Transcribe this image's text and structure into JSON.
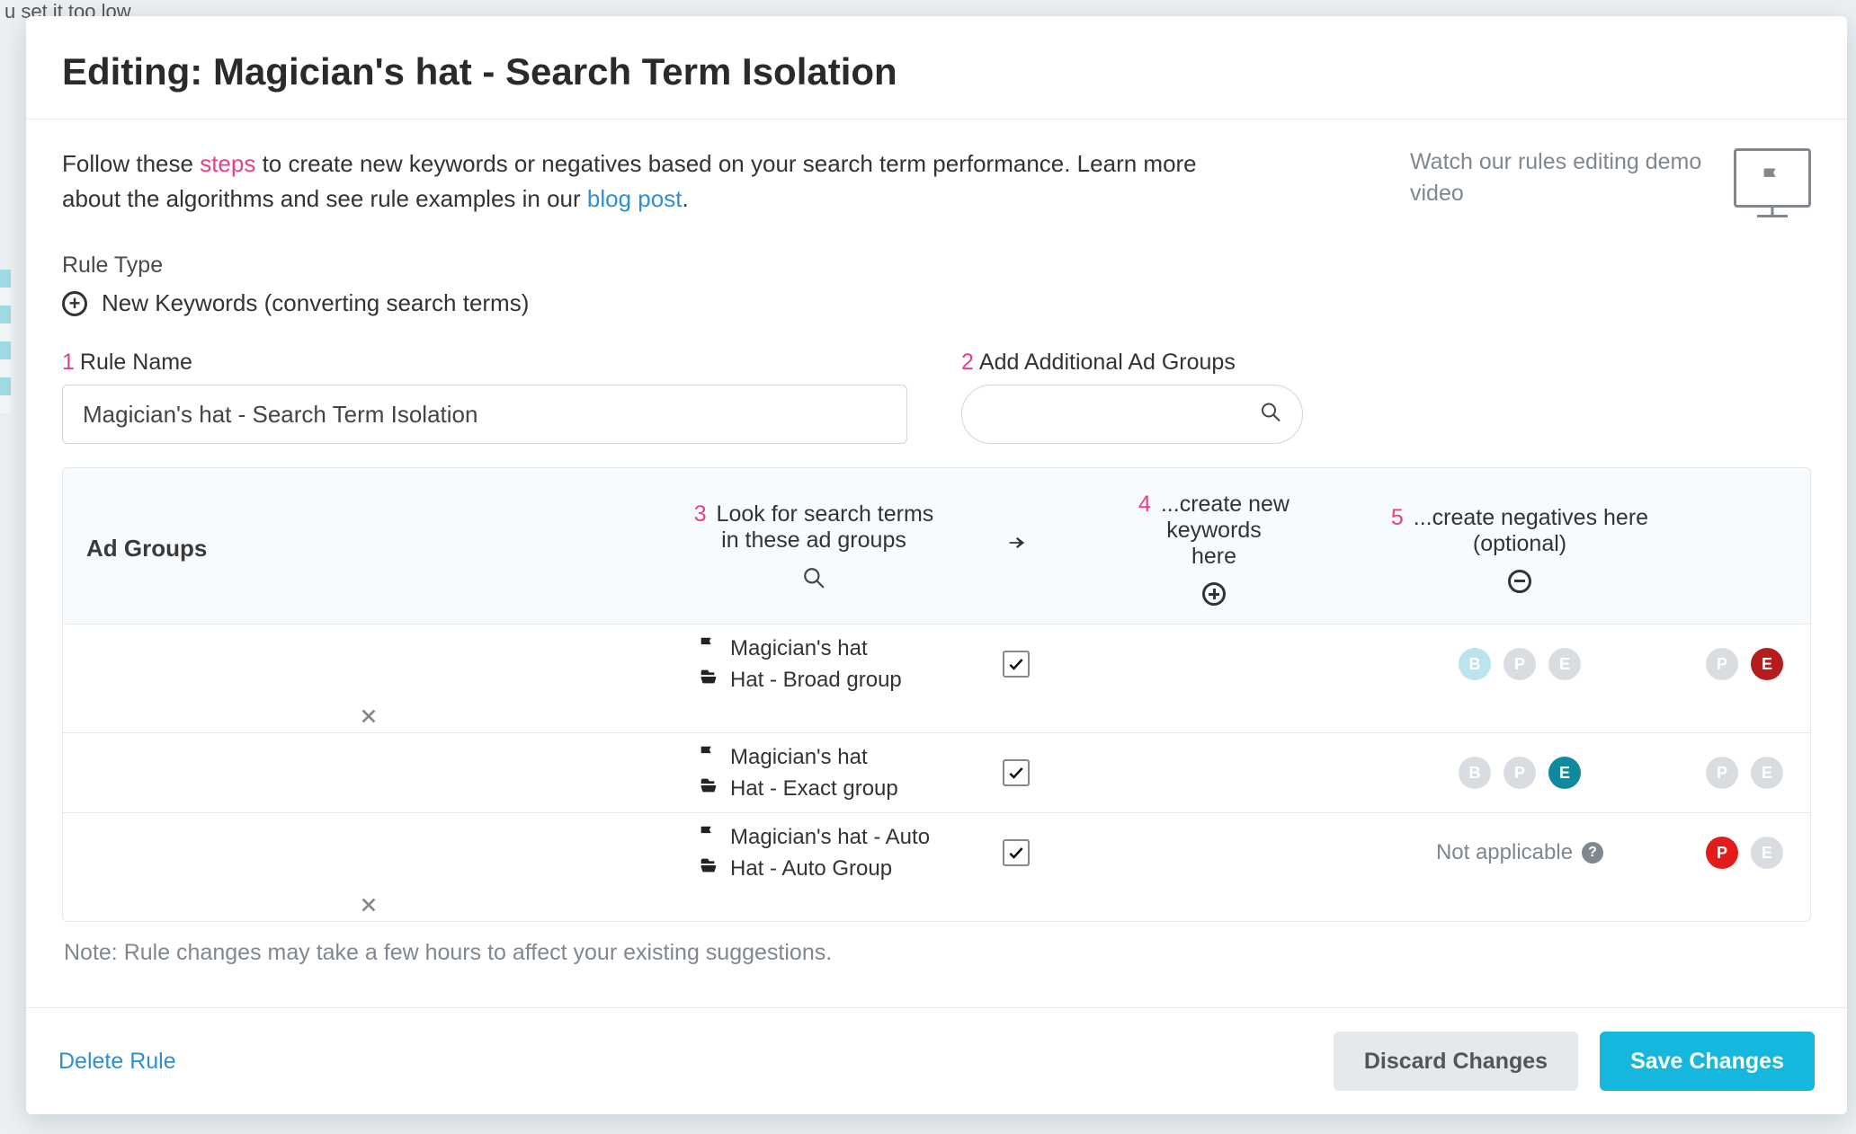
{
  "backdrop_snippet": "u set it too low",
  "header": {
    "title": "Editing: Magician's hat - Search Term Isolation"
  },
  "intro": {
    "part1": "Follow these ",
    "steps_link": "steps",
    "part2": " to create new keywords or negatives based on your search term performance. Learn more about the algorithms and see rule examples in our ",
    "blog_link": "blog post",
    "part3": "."
  },
  "demo": {
    "text": "Watch our rules editing demo video"
  },
  "rule_type": {
    "label": "Rule Type",
    "value": "New Keywords (converting search terms)"
  },
  "step1": {
    "num": "1",
    "label": "Rule Name",
    "value": "Magician's hat - Search Term Isolation"
  },
  "step2": {
    "num": "2",
    "label": "Add Additional Ad Groups",
    "placeholder": ""
  },
  "grid_header": {
    "adgroups": "Ad Groups",
    "c3_num": "3",
    "c3_line1": "Look for search terms",
    "c3_line2": "in these ad groups",
    "c4_num": "4",
    "c4_line1": "...create new keywords",
    "c4_line2": "here",
    "c5_num": "5",
    "c5_line1": "...create negatives here",
    "c5_line2": "(optional)"
  },
  "rows": [
    {
      "campaign": "Magician's hat",
      "adgroup": "Hat - Broad group",
      "checked": true,
      "create_kw": {
        "na": false,
        "b": "b-light",
        "p": "off",
        "e": "off"
      },
      "negatives": {
        "p": "off",
        "e": "red-e"
      },
      "removable": true
    },
    {
      "campaign": "Magician's hat",
      "adgroup": "Hat - Exact group",
      "checked": true,
      "create_kw": {
        "na": false,
        "b": "off",
        "p": "off",
        "e": "teal"
      },
      "negatives": {
        "p": "off",
        "e": "off"
      },
      "removable": false
    },
    {
      "campaign": "Magician's hat - Auto",
      "adgroup": "Hat - Auto Group",
      "checked": true,
      "create_kw": {
        "na": true
      },
      "negatives": {
        "p": "red-p",
        "e": "off"
      },
      "removable": true
    }
  ],
  "na_label": "Not applicable",
  "badge_letters": {
    "b": "B",
    "p": "P",
    "e": "E"
  },
  "note": "Note: Rule changes may take a few hours to affect your existing suggestions.",
  "footer": {
    "delete": "Delete Rule",
    "discard": "Discard Changes",
    "save": "Save Changes"
  }
}
